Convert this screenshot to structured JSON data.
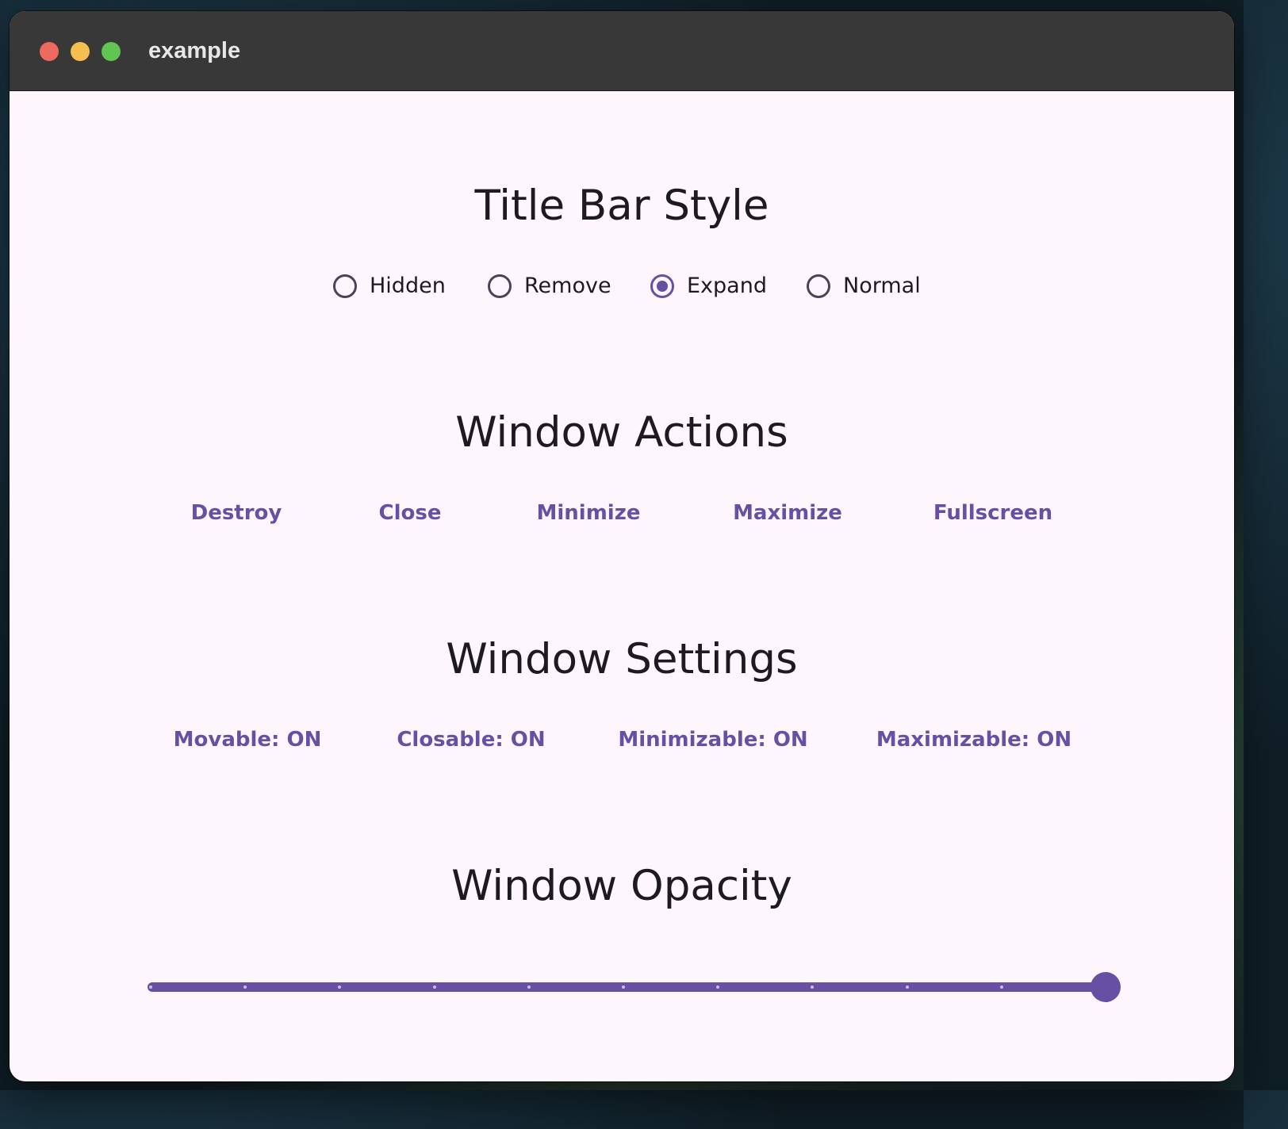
{
  "window": {
    "title": "example",
    "traffic_lights": {
      "close_color": "#ee6a5f",
      "minimize_color": "#f5bf4f",
      "maximize_color": "#61c554"
    }
  },
  "title_bar_style": {
    "heading": "Title Bar Style",
    "options": [
      {
        "label": "Hidden",
        "selected": false
      },
      {
        "label": "Remove",
        "selected": false
      },
      {
        "label": "Expand",
        "selected": true
      },
      {
        "label": "Normal",
        "selected": false
      }
    ]
  },
  "window_actions": {
    "heading": "Window Actions",
    "buttons": [
      "Destroy",
      "Close",
      "Minimize",
      "Maximize",
      "Fullscreen"
    ]
  },
  "window_settings": {
    "heading": "Window Settings",
    "buttons": [
      "Movable: ON",
      "Closable: ON",
      "Minimizable: ON",
      "Maximizable: ON"
    ]
  },
  "window_opacity": {
    "heading": "Window Opacity",
    "slider": {
      "value": 1.0,
      "min": 0.0,
      "max": 1.0,
      "divisions": 10
    }
  },
  "colors": {
    "accent": "#6750a4",
    "background": "#fdf7fd",
    "titlebar": "#383838",
    "text": "#1d1b20"
  }
}
